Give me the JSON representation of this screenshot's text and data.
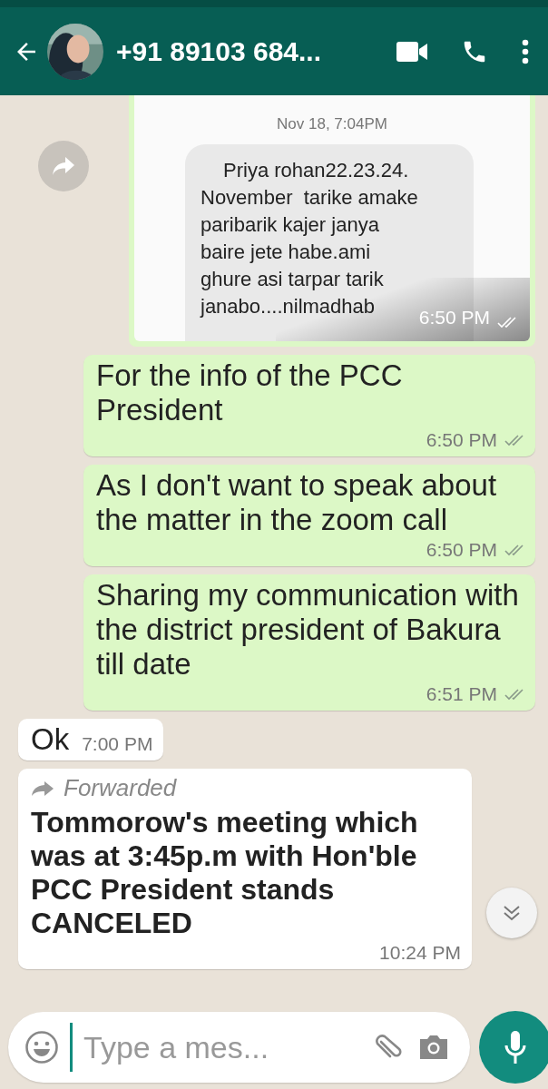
{
  "header": {
    "title": "+91 89103 684..."
  },
  "messages": [
    {
      "sms_date": "Nov 18, 7:04PM",
      "sms_lines": [
        "Priya rohan22.23.24.",
        "November  tarike amake",
        "paribarik kajer janya",
        "baire jete habe.ami",
        "ghure asi tarpar tarik",
        "janabo....nilmadhab"
      ],
      "time": "6:50 PM"
    },
    {
      "kind": "outgoing",
      "text": "For the info of the PCC President",
      "time": "6:50 PM"
    },
    {
      "kind": "outgoing",
      "text": "As I don't want to speak about the matter in the zoom call",
      "time": "6:50 PM"
    },
    {
      "kind": "outgoing",
      "text": "Sharing my communication with the district president of Bakura till date",
      "time": "6:51 PM"
    },
    {
      "kind": "incoming",
      "text": "Ok",
      "time": "7:00 PM"
    },
    {
      "kind": "forwarded",
      "label": "Forwarded",
      "text": "Tommorow's meeting which was at 3:45p.m with Hon'ble PCC President stands CANCELED",
      "time": "10:24 PM"
    }
  ],
  "composer": {
    "placeholder": "Type a mes..."
  }
}
